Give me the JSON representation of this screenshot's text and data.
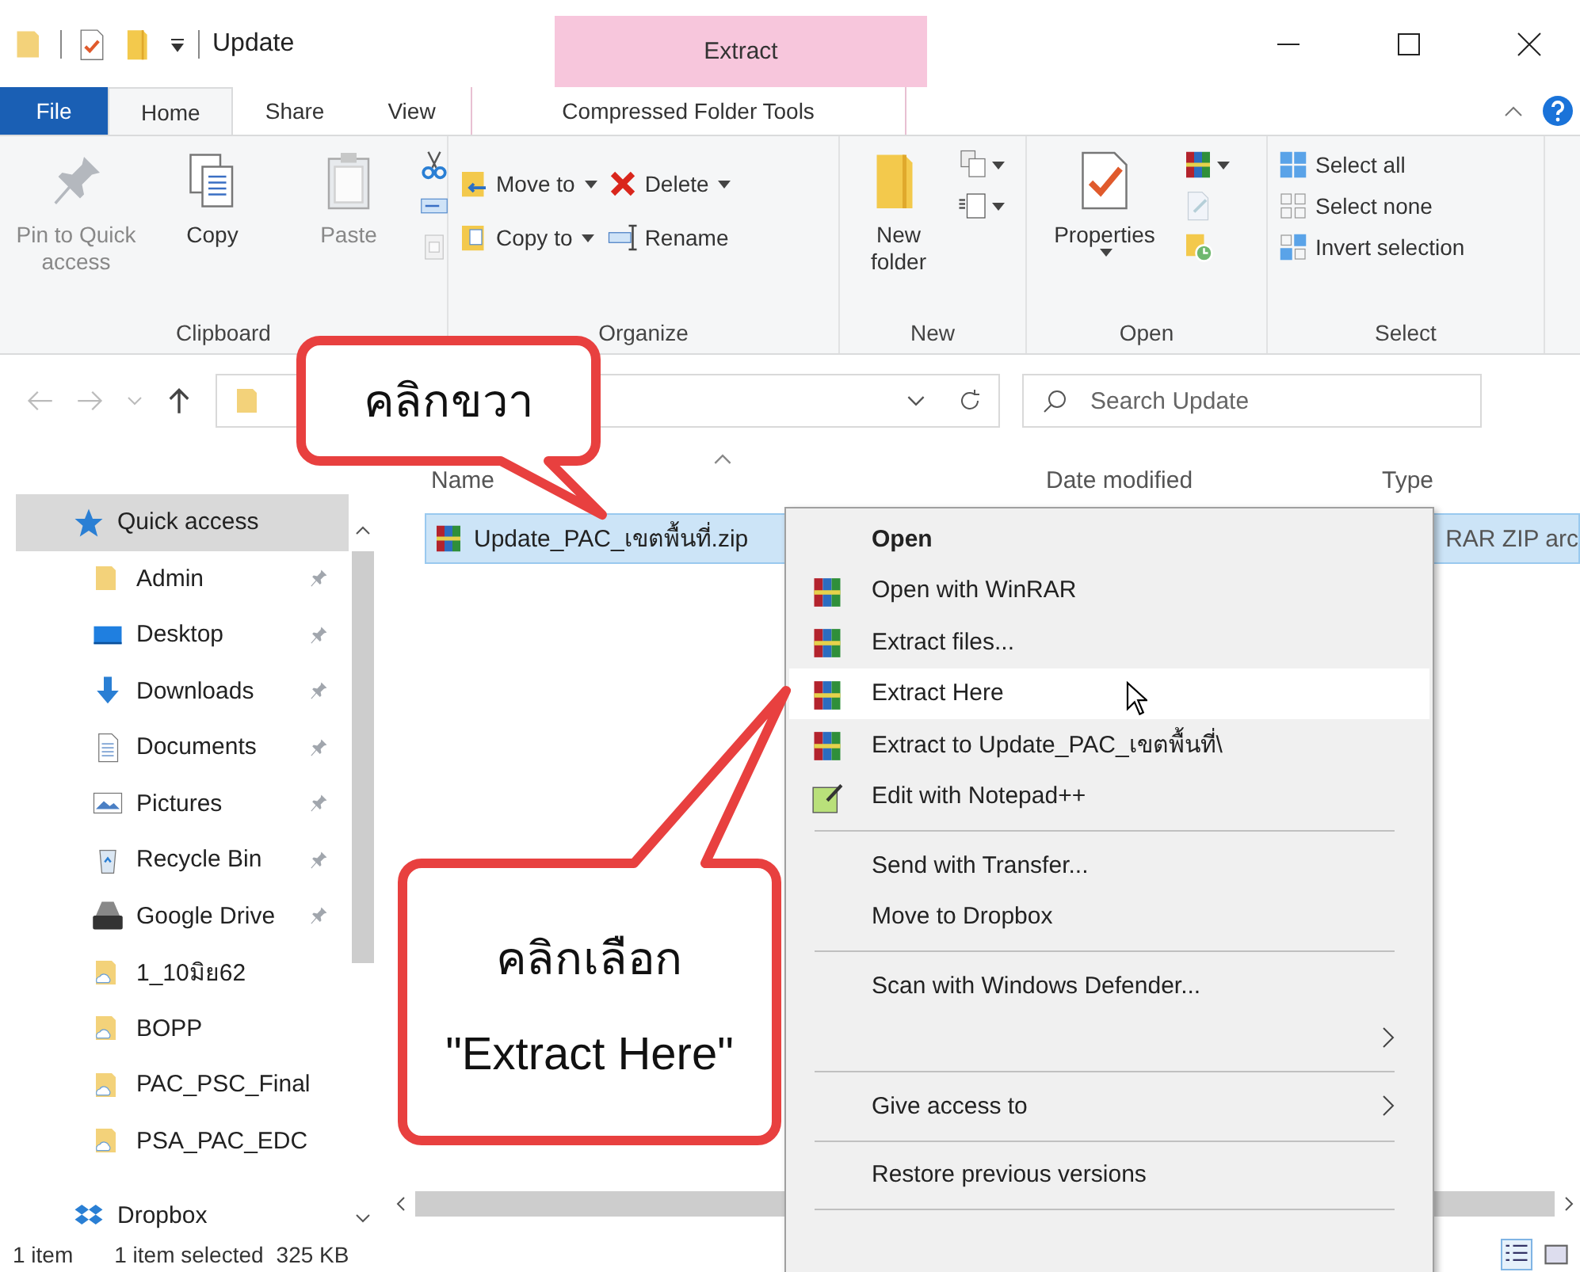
{
  "window": {
    "title": "Update",
    "context_header": "Extract"
  },
  "ribbon_tabs": [
    {
      "label": "File",
      "kind": "file",
      "selected": false
    },
    {
      "label": "Home",
      "kind": "tab",
      "selected": true
    },
    {
      "label": "Share",
      "kind": "tab",
      "selected": false
    },
    {
      "label": "View",
      "kind": "tab",
      "selected": false
    },
    {
      "label": "Compressed Folder Tools",
      "kind": "context",
      "selected": false
    }
  ],
  "ribbon_groups": [
    {
      "name": "Clipboard",
      "columns": [
        [
          {
            "label": "Pin to Quick access",
            "kind": "large",
            "disabled": true
          }
        ],
        [
          {
            "label": "Copy",
            "kind": "large",
            "disabled": false
          }
        ],
        [
          {
            "label": "Paste",
            "kind": "large",
            "disabled": true
          }
        ],
        [
          {
            "kind": "icon",
            "disabled": false
          },
          {
            "kind": "icon",
            "disabled": false
          },
          {
            "kind": "icon",
            "disabled": true
          }
        ]
      ]
    },
    {
      "name": "Organize",
      "columns": [
        [
          {
            "label": "Move to",
            "kind": "small",
            "dropdown": true,
            "disabled": false
          },
          {
            "label": "Copy to",
            "kind": "small",
            "dropdown": true,
            "disabled": false
          }
        ],
        [
          {
            "label": "Delete",
            "kind": "small",
            "dropdown": true,
            "disabled": false
          },
          {
            "label": "Rename",
            "kind": "small",
            "dropdown": false,
            "disabled": false
          }
        ]
      ]
    },
    {
      "name": "New",
      "columns": [
        [
          {
            "label": "New folder",
            "kind": "large",
            "disabled": false
          }
        ],
        [
          {
            "kind": "icon",
            "dropdown": true,
            "disabled": false
          },
          {
            "kind": "icon",
            "dropdown": true,
            "disabled": false
          }
        ]
      ]
    },
    {
      "name": "Open",
      "columns": [
        [
          {
            "label": "Properties",
            "kind": "large",
            "dropdown": true,
            "disabled": false
          }
        ],
        [
          {
            "kind": "icon",
            "dropdown": true,
            "disabled": false
          },
          {
            "kind": "icon",
            "dropdown": false,
            "disabled": true
          },
          {
            "kind": "icon",
            "dropdown": false,
            "disabled": false
          }
        ]
      ]
    },
    {
      "name": "Select",
      "columns": [
        [
          {
            "label": "Select all",
            "kind": "small",
            "disabled": false
          },
          {
            "label": "Select none",
            "kind": "small",
            "disabled": false
          },
          {
            "label": "Invert selection",
            "kind": "small",
            "disabled": false
          }
        ]
      ]
    }
  ],
  "search": {
    "placeholder": "Search Update"
  },
  "navigation": [
    {
      "label": "Quick access",
      "kind": "star",
      "selected": true,
      "pinned": false,
      "children": [
        {
          "label": "Admin",
          "kind": "folder",
          "selected": false,
          "pinned": true
        },
        {
          "label": "Desktop",
          "kind": "desktop",
          "selected": false,
          "pinned": true
        },
        {
          "label": "Downloads",
          "kind": "downloads",
          "selected": false,
          "pinned": true
        },
        {
          "label": "Documents",
          "kind": "documents",
          "selected": false,
          "pinned": true
        },
        {
          "label": "Pictures",
          "kind": "pictures",
          "selected": false,
          "pinned": true
        },
        {
          "label": "Recycle Bin",
          "kind": "recycle",
          "selected": false,
          "pinned": true
        },
        {
          "label": "Google Drive",
          "kind": "drive",
          "selected": false,
          "pinned": true
        },
        {
          "label": "1_10มิย62",
          "kind": "cloud-folder",
          "selected": false,
          "pinned": false
        },
        {
          "label": "BOPP",
          "kind": "cloud-folder",
          "selected": false,
          "pinned": false
        },
        {
          "label": "PAC_PSC_Final",
          "kind": "cloud-folder",
          "selected": false,
          "pinned": false
        },
        {
          "label": "PSA_PAC_EDC",
          "kind": "cloud-folder",
          "selected": false,
          "pinned": false
        }
      ]
    },
    {
      "label": "Dropbox",
      "kind": "dropbox",
      "selected": false,
      "pinned": false
    }
  ],
  "table": {
    "columns": [
      "Name",
      "Date modified",
      "Type"
    ],
    "rows": [
      {
        "name": "Update_PAC_เขตพื้นที่.zip",
        "type": "RAR ZIP arc",
        "selected": true
      }
    ]
  },
  "context_menu": [
    {
      "label": "Open",
      "kind": "default"
    },
    {
      "label": "Open with WinRAR",
      "kind": "winrar",
      "selected": false
    },
    {
      "label": "Extract files...",
      "kind": "winrar",
      "selected": false
    },
    {
      "label": "Extract Here",
      "kind": "winrar",
      "selected": true
    },
    {
      "label": "Extract to Update_PAC_เขตพื้นที่\\",
      "kind": "winrar",
      "selected": false
    },
    {
      "label": "Edit with Notepad++",
      "kind": "notepad",
      "selected": false
    },
    {
      "kind": "separator"
    },
    {
      "label": "Send with Transfer...",
      "kind": "plain",
      "selected": false
    },
    {
      "label": "Move to Dropbox",
      "kind": "plain",
      "selected": false
    },
    {
      "kind": "separator"
    },
    {
      "label": "Scan with Windows Defender...",
      "kind": "plain",
      "selected": false
    },
    {
      "kind": "submenu"
    },
    {
      "kind": "separator"
    },
    {
      "label": "Give access to",
      "kind": "submenu",
      "selected": false
    },
    {
      "kind": "separator"
    },
    {
      "label": "Restore previous versions",
      "kind": "plain",
      "selected": false
    },
    {
      "kind": "separator"
    }
  ],
  "callouts": [
    {
      "lines": [
        "คลิกขวา"
      ]
    },
    {
      "lines": [
        "คลิกเลือก",
        "\"Extract Here\""
      ]
    }
  ],
  "status_bar": {
    "items": "1 item",
    "selection": "1 item selected",
    "size": "325 KB"
  }
}
